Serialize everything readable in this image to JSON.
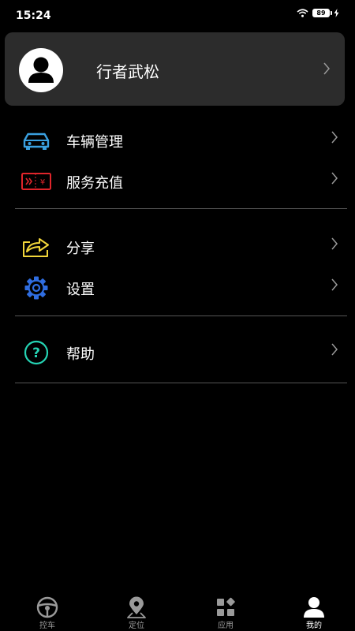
{
  "status_bar": {
    "time": "15:24",
    "battery": "89"
  },
  "profile": {
    "name": "行者武松"
  },
  "menu": {
    "items": [
      {
        "label": "车辆管理",
        "icon": "car-icon",
        "color": "#3aa0e0"
      },
      {
        "label": "服务充值",
        "icon": "recharge-ticket-icon",
        "color": "#e0252b"
      },
      {
        "label": "分享",
        "icon": "share-icon",
        "color": "#f2d63a"
      },
      {
        "label": "设置",
        "icon": "gear-icon",
        "color": "#2f6de0"
      },
      {
        "label": "帮助",
        "icon": "help-icon",
        "color": "#25d4b4"
      }
    ]
  },
  "tabbar": {
    "active": "我的",
    "tabs": [
      {
        "label": "控车",
        "icon": "steering-wheel-icon"
      },
      {
        "label": "定位",
        "icon": "location-pin-icon"
      },
      {
        "label": "应用",
        "icon": "apps-grid-icon"
      },
      {
        "label": "我的",
        "icon": "user-icon"
      }
    ]
  },
  "colors": {
    "background": "#000000",
    "card": "#2c2c2c",
    "divider": "#555555",
    "chevron": "#9a9a9a",
    "tab_inactive": "#9a9a9a",
    "tab_active": "#ffffff"
  }
}
